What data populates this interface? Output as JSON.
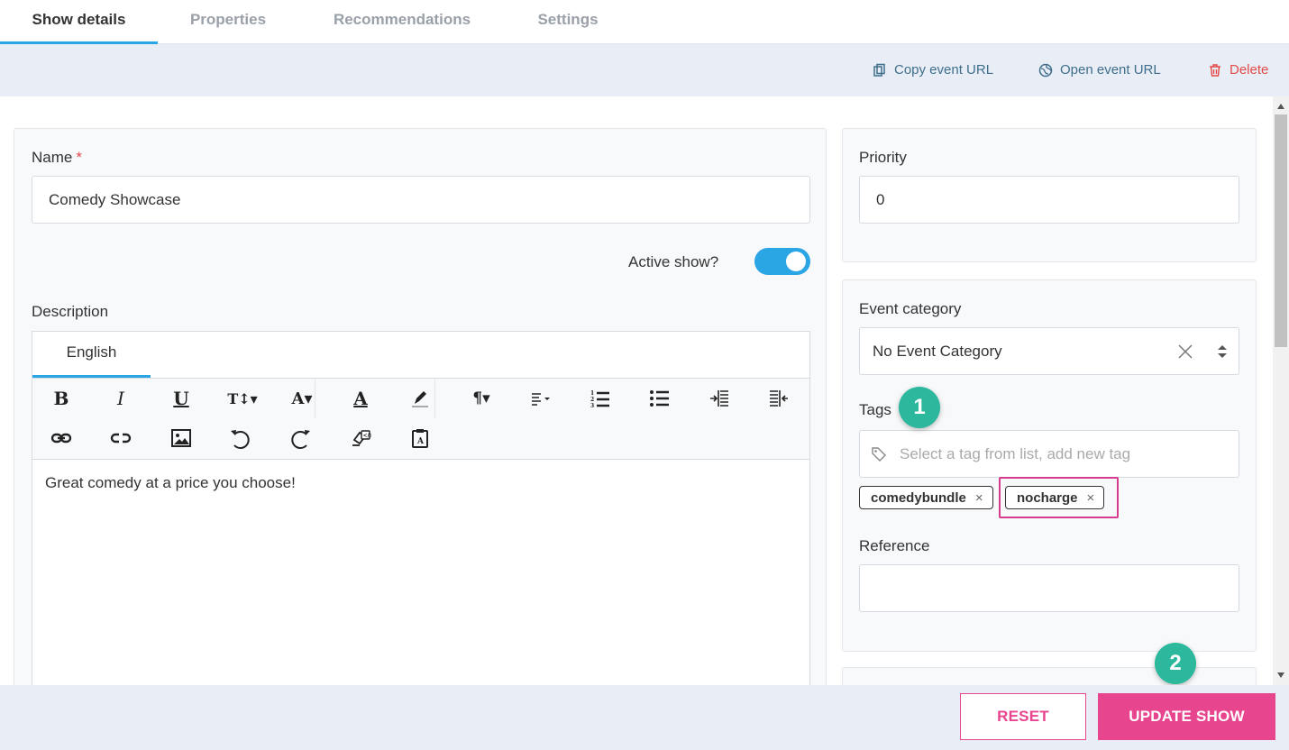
{
  "tabs": [
    {
      "label": "Show details",
      "active": true
    },
    {
      "label": "Properties",
      "active": false
    },
    {
      "label": "Recommendations",
      "active": false
    },
    {
      "label": "Settings",
      "active": false
    }
  ],
  "actions": {
    "copy_url": "Copy event URL",
    "open_url": "Open event URL",
    "delete": "Delete"
  },
  "form": {
    "name_label": "Name",
    "required_mark": "*",
    "name_value": "Comedy Showcase",
    "active_label": "Active show?",
    "active_on": true,
    "description_label": "Description",
    "language_tab": "English",
    "description_text": "Great comedy at a price you choose!"
  },
  "toolbar_icons": [
    "bold-icon",
    "italic-icon",
    "underline-icon",
    "font-size-icon",
    "font-family-icon",
    "text-color-icon",
    "highlight-icon",
    "paragraph-format-icon",
    "align-icon",
    "ordered-list-icon",
    "unordered-list-icon",
    "indent-icon",
    "outdent-icon",
    "insert-link-icon",
    "unlink-icon",
    "insert-image-icon",
    "undo-icon",
    "redo-icon",
    "clear-formatting-icon",
    "paste-text-icon"
  ],
  "sidebar": {
    "priority_label": "Priority",
    "priority_value": "0",
    "category_label": "Event category",
    "category_value": "No Event Category",
    "tags_label": "Tags",
    "tags_placeholder": "Select a tag from list, add new tag",
    "tags": [
      "comedybundle",
      "nocharge"
    ],
    "reference_label": "Reference",
    "reference_value": ""
  },
  "annotations": {
    "step1": "1",
    "step2": "2",
    "highlight_color": "#d63b8f",
    "badge_color": "#2bb89c"
  },
  "footer": {
    "reset_label": "RESET",
    "update_label": "UPDATE SHOW"
  },
  "colors": {
    "accent": "#2aa6e4",
    "primary_button": "#e8458f",
    "danger": "#e24a4a",
    "link": "#3f6e8c"
  }
}
